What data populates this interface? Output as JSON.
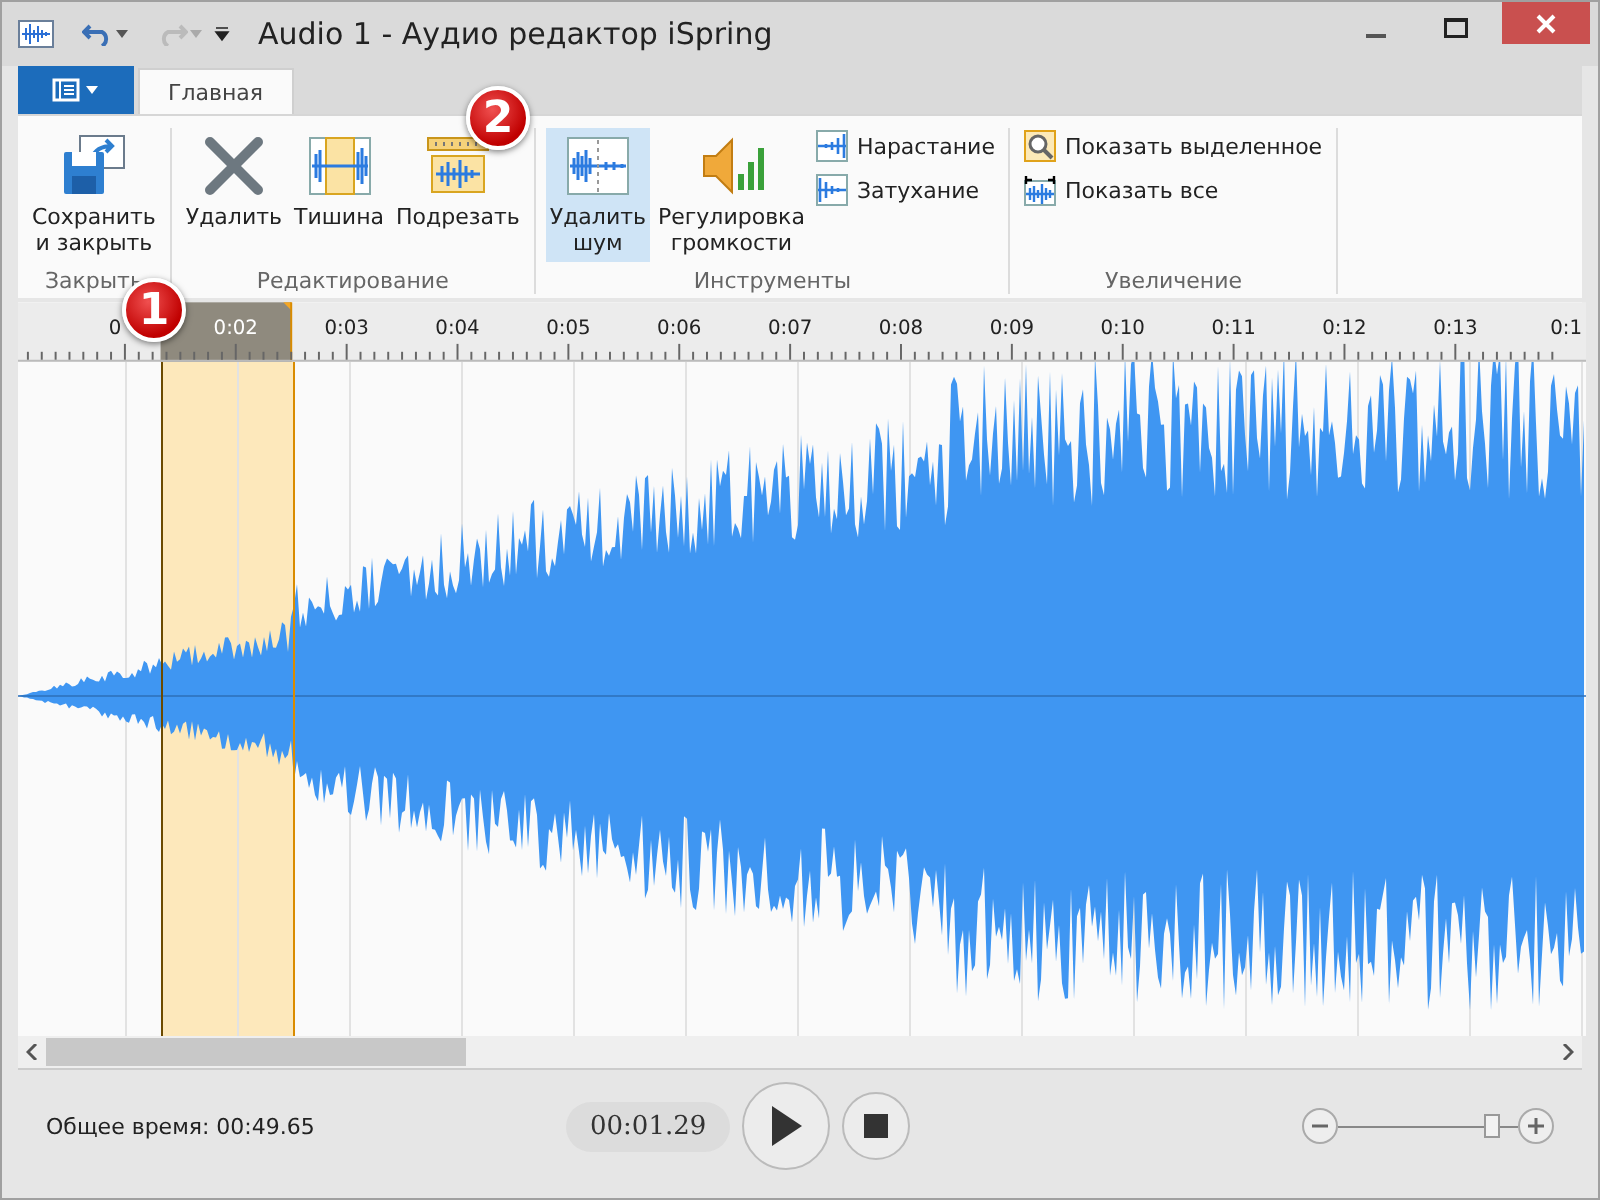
{
  "window": {
    "title": "Audio 1 - Аудио редактор iSpring"
  },
  "quick_access": [
    {
      "kind": "undo",
      "disabled": false
    },
    {
      "kind": "redo",
      "disabled": true
    }
  ],
  "ribbon_tabs": [
    {
      "label": "Главная",
      "selected": true
    }
  ],
  "ribbon_groups": [
    {
      "label": "Закрыть",
      "buttons": [
        {
          "kind": "large",
          "label": "Сохранить\nи закрыть",
          "hovered": false
        }
      ]
    },
    {
      "label": "Редактирование",
      "buttons": [
        {
          "kind": "large",
          "label": "Удалить",
          "hovered": false
        },
        {
          "kind": "large",
          "label": "Тишина",
          "hovered": false
        },
        {
          "kind": "large",
          "label": "Подрезать",
          "hovered": false
        }
      ]
    },
    {
      "label": "Инструменты",
      "buttons": [
        {
          "kind": "large",
          "label": "Удалить\nшум",
          "hovered": true
        },
        {
          "kind": "large",
          "label": "Регулировка\nгромкости",
          "hovered": false
        },
        {
          "kind": "small",
          "label": "Нарастание",
          "hovered": false
        },
        {
          "kind": "small",
          "label": "Затухание",
          "hovered": false
        }
      ]
    },
    {
      "label": "Увеличение",
      "buttons": [
        {
          "kind": "small",
          "label": "Показать выделенное",
          "hovered": false
        },
        {
          "kind": "small",
          "label": "Показать все",
          "hovered": false
        }
      ]
    }
  ],
  "markers": [
    {
      "label": "1"
    },
    {
      "label": "2"
    }
  ],
  "timeline": {
    "labels": [
      "0",
      "0:02",
      "0:03",
      "0:04",
      "0:05",
      "0:06",
      "0:07",
      "0:08",
      "0:09",
      "0:10",
      "0:11",
      "0:12",
      "0:13",
      "0:1"
    ]
  },
  "status": {
    "total_time": "Общее время: 00:49.65",
    "position": "00:01.29",
    "zoom": {
      "level": 0.87
    }
  }
}
